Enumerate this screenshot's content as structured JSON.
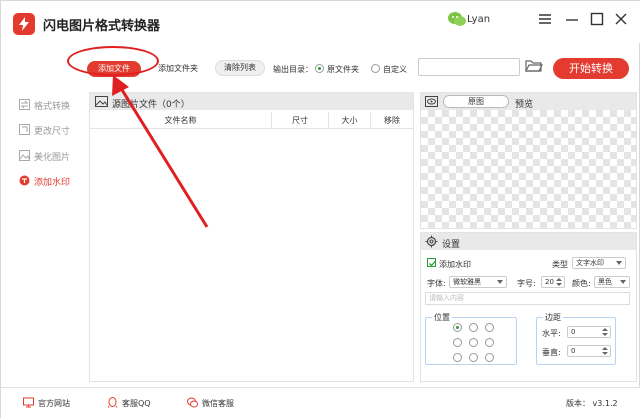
{
  "app": {
    "title": "闪电图片格式转换器",
    "user": "Lyan"
  },
  "toolbar": {
    "add_file": "添加文件",
    "add_folder": "添加文件夹",
    "clear_list": "清除列表",
    "output_label": "输出目录：",
    "opt_source": "原文件夹",
    "opt_custom": "自定义",
    "path_value": "",
    "start": "开始转换"
  },
  "sidebar": {
    "items": [
      {
        "label": "格式转换"
      },
      {
        "label": "更改尺寸"
      },
      {
        "label": "美化图片"
      },
      {
        "label": "添加水印"
      }
    ]
  },
  "file_panel": {
    "title": "源图片文件（0个）",
    "columns": [
      "文件名称",
      "尺寸",
      "大小",
      "移除"
    ]
  },
  "preview": {
    "mode": "原图",
    "label": "预览"
  },
  "settings": {
    "title": "设置",
    "add_watermark": "添加水印",
    "type_label": "类型",
    "type_value": "文字水印",
    "font_label": "字体:",
    "font_value": "微软雅黑",
    "size_label": "字号:",
    "size_value": "20",
    "color_label": "颜色:",
    "color_value": "黑色",
    "content_placeholder": "请输入内容",
    "position_label": "位置",
    "margin_label": "边距",
    "horizontal_label": "水平:",
    "horizontal_value": "0",
    "vertical_label": "垂直:",
    "vertical_value": "0"
  },
  "footer": {
    "website": "官方网站",
    "qq": "客服QQ",
    "wechat": "微信客服",
    "version": "版本： v3.1.2"
  },
  "colors": {
    "accent": "#e33b2f",
    "annotation": "#e02020",
    "check": "#2a9d3a"
  }
}
